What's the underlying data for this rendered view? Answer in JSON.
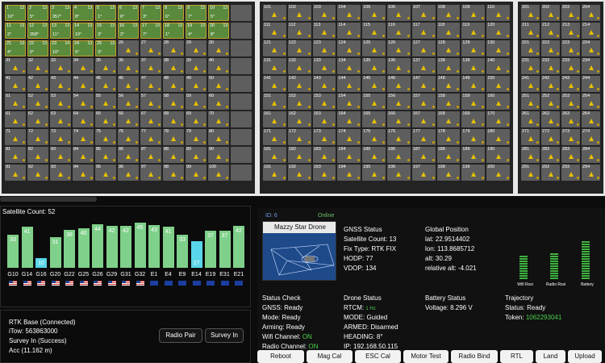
{
  "grid": {
    "panel_a": [
      {
        "n": "1",
        "s": "13",
        "h": "10°",
        "active": true
      },
      {
        "n": "2",
        "s": "13",
        "h": "5°",
        "active": true
      },
      {
        "n": "3",
        "s": "13",
        "h": "357°",
        "active": true
      },
      {
        "n": "4",
        "s": "13",
        "h": "8°",
        "active": true
      },
      {
        "n": "5",
        "s": "13",
        "h": "1°",
        "active": true
      },
      {
        "n": "6",
        "s": "13",
        "h": "6°",
        "active": true
      },
      {
        "n": "7",
        "s": "13",
        "h": "3°",
        "active": true
      },
      {
        "n": "8",
        "s": "13",
        "h": "6°",
        "active": true
      },
      {
        "n": "9",
        "s": "13",
        "h": "7°",
        "active": true
      },
      {
        "n": "10",
        "s": "13",
        "h": "5°",
        "active": true
      },
      {
        "n": "",
        "s": "",
        "h": "",
        "active": false
      },
      {
        "n": "11",
        "s": "13",
        "h": "2°",
        "active": true
      },
      {
        "n": "12",
        "s": "13",
        "h": "358°",
        "active": true
      },
      {
        "n": "13",
        "s": "13",
        "h": "11°",
        "active": true
      },
      {
        "n": "14",
        "s": "13",
        "h": "10°",
        "active": true
      },
      {
        "n": "15",
        "s": "13",
        "h": "3°",
        "active": true
      },
      {
        "n": "16",
        "s": "13",
        "h": "2°",
        "active": true
      },
      {
        "n": "17",
        "s": "13",
        "h": "7°",
        "active": true
      },
      {
        "n": "18",
        "s": "13",
        "h": "1°",
        "active": true
      },
      {
        "n": "19",
        "s": "13",
        "h": "4°",
        "active": true
      },
      {
        "n": "20",
        "s": "13",
        "h": "8°",
        "active": true
      },
      {
        "n": "",
        "s": "",
        "h": "",
        "active": false
      },
      {
        "n": "21",
        "s": "13",
        "h": "4°",
        "active": true
      },
      {
        "n": "22",
        "s": "13",
        "h": "0°",
        "active": true
      },
      {
        "n": "23",
        "s": "14",
        "h": "10°",
        "active": true
      },
      {
        "n": "24",
        "s": "13",
        "h": "5°",
        "active": true
      },
      {
        "n": "25",
        "s": "13",
        "h": "3°",
        "active": true
      },
      {
        "n": "26",
        "s": "",
        "h": "",
        "active": false
      },
      {
        "n": "27",
        "s": "",
        "h": "",
        "active": false
      },
      {
        "n": "28",
        "s": "",
        "h": "",
        "active": false
      },
      {
        "n": "29",
        "s": "",
        "h": "",
        "active": false
      },
      {
        "n": "30",
        "s": "",
        "h": "",
        "active": false
      },
      {
        "n": "",
        "s": "",
        "h": "",
        "active": false
      },
      {
        "n": "31"
      },
      {
        "n": "32"
      },
      {
        "n": "33"
      },
      {
        "n": "34"
      },
      {
        "n": "35"
      },
      {
        "n": "36"
      },
      {
        "n": "37"
      },
      {
        "n": "38"
      },
      {
        "n": "39"
      },
      {
        "n": "40"
      },
      {
        "n": ""
      },
      {
        "n": "41"
      },
      {
        "n": "42"
      },
      {
        "n": "43"
      },
      {
        "n": "44"
      },
      {
        "n": "45"
      },
      {
        "n": "46"
      },
      {
        "n": "47"
      },
      {
        "n": "48"
      },
      {
        "n": "49"
      },
      {
        "n": "50"
      },
      {
        "n": ""
      },
      {
        "n": "51"
      },
      {
        "n": "52"
      },
      {
        "n": "53"
      },
      {
        "n": "54"
      },
      {
        "n": "55"
      },
      {
        "n": "56"
      },
      {
        "n": "57"
      },
      {
        "n": "58"
      },
      {
        "n": "59"
      },
      {
        "n": "60"
      },
      {
        "n": ""
      },
      {
        "n": "61"
      },
      {
        "n": "62"
      },
      {
        "n": "63"
      },
      {
        "n": "64"
      },
      {
        "n": "65"
      },
      {
        "n": "66"
      },
      {
        "n": "67"
      },
      {
        "n": "68"
      },
      {
        "n": "69"
      },
      {
        "n": "70"
      },
      {
        "n": ""
      },
      {
        "n": "71"
      },
      {
        "n": "72"
      },
      {
        "n": "73"
      },
      {
        "n": "74"
      },
      {
        "n": "75"
      },
      {
        "n": "76"
      },
      {
        "n": "77"
      },
      {
        "n": "78"
      },
      {
        "n": "79"
      },
      {
        "n": "80"
      },
      {
        "n": ""
      },
      {
        "n": "81"
      },
      {
        "n": "82"
      },
      {
        "n": "83"
      },
      {
        "n": "84"
      },
      {
        "n": "85"
      },
      {
        "n": "86"
      },
      {
        "n": "87"
      },
      {
        "n": "88"
      },
      {
        "n": "89"
      },
      {
        "n": "90"
      },
      {
        "n": ""
      },
      {
        "n": "91"
      },
      {
        "n": "92"
      },
      {
        "n": "93"
      },
      {
        "n": "94"
      },
      {
        "n": "95"
      },
      {
        "n": "96"
      },
      {
        "n": "97"
      },
      {
        "n": "98"
      },
      {
        "n": "99"
      },
      {
        "n": "100"
      },
      {
        "n": ""
      }
    ],
    "panel_b_start": 101,
    "panel_b_count": 100,
    "panel_c": [
      "201",
      "202",
      "203",
      "204",
      "211",
      "212",
      "213",
      "214",
      "221",
      "222",
      "223",
      "224",
      "231",
      "232",
      "233",
      "234",
      "241",
      "242",
      "243",
      "244",
      "251",
      "252",
      "253",
      "254",
      "261",
      "262",
      "263",
      "264",
      "271",
      "272",
      "273",
      "274",
      "281",
      "282",
      "283",
      "284",
      "291",
      "292",
      "293",
      "294"
    ]
  },
  "satellites": {
    "title": "Satellite Count: 52",
    "items": [
      {
        "label": "G10",
        "value": "33",
        "level": 33,
        "color": "green",
        "flag": "us"
      },
      {
        "label": "G14",
        "value": "41",
        "level": 41,
        "color": "green",
        "flag": "us"
      },
      {
        "label": "G16",
        "value": "10",
        "level": 10,
        "color": "cyan",
        "flag": "us"
      },
      {
        "label": "G20",
        "value": "31",
        "level": 31,
        "color": "green",
        "flag": "us"
      },
      {
        "label": "G22",
        "value": "38",
        "level": 38,
        "color": "green",
        "flag": "us"
      },
      {
        "label": "G25",
        "value": "40",
        "level": 40,
        "color": "green",
        "flag": "us"
      },
      {
        "label": "G26",
        "value": "44",
        "level": 44,
        "color": "green",
        "flag": "us"
      },
      {
        "label": "G29",
        "value": "42",
        "level": 42,
        "color": "green",
        "flag": "us"
      },
      {
        "label": "G31",
        "value": "42",
        "level": 42,
        "color": "green",
        "flag": "us"
      },
      {
        "label": "G32",
        "value": "45",
        "level": 45,
        "color": "green",
        "flag": "us"
      },
      {
        "label": "E1",
        "value": "43",
        "level": 43,
        "color": "green",
        "flag": "eu"
      },
      {
        "label": "E4",
        "value": "41",
        "level": 41,
        "color": "green",
        "flag": "eu"
      },
      {
        "label": "E9",
        "value": "33",
        "level": 33,
        "color": "green",
        "flag": "eu"
      },
      {
        "label": "E14",
        "value": "27",
        "level": 27,
        "color": "cyan",
        "flag": "eu"
      },
      {
        "label": "E19",
        "value": "37",
        "level": 37,
        "color": "green",
        "flag": "eu"
      },
      {
        "label": "E31",
        "value": "37",
        "level": 37,
        "color": "green",
        "flag": "eu"
      },
      {
        "label": "E21",
        "value": "42",
        "level": 42,
        "color": "green",
        "flag": "eu"
      }
    ]
  },
  "rtk": {
    "base": "RTK Base (Connected)",
    "itow": "iTow: 563863000",
    "survey": "Survey In (Success)",
    "acc": "Acc (11.162 m)",
    "radio_pair": "Radio Pair",
    "survey_in": "Survey In"
  },
  "drone": {
    "id": "ID: 6",
    "online": "Online",
    "name": "Mazzy Star Drone",
    "gnss": {
      "title": "GNSS Status",
      "sat": "Satellite Count: 13",
      "fix": "Fix Type: RTK FIX",
      "hodp": "HODP: 77",
      "vdop": "VDOP: 134"
    },
    "position": {
      "title": "Global Position",
      "lat": "lat: 22.9514402",
      "lon": "lon: 113.8685712",
      "alt": "alt: 30.29",
      "rel": "relative alt: -4.021"
    },
    "signals": [
      {
        "label": "Wifi Rssi",
        "level": 0.55
      },
      {
        "label": "Radio Rssi",
        "level": 0.6
      },
      {
        "label": "Battery",
        "level": 0.9
      }
    ],
    "status_check": {
      "title": "Status Check",
      "gnss": "GNSS: Ready",
      "mode": "Mode: Ready",
      "arming": "Arming: Ready",
      "wifi_label": "Wifi Channel:",
      "wifi_value": "ON",
      "radio_label": "Radio Channel:",
      "radio_value": "ON"
    },
    "drone_status": {
      "title": "Drone Status",
      "rtcm_label": "RTCM:",
      "rtcm_value": "1 Hz",
      "mode": "MODE: Guided",
      "armed": "ARMED: Disarmed",
      "heading": "HEADING: 8°",
      "ip": "IP: 192.168.50.115"
    },
    "battery": {
      "title": "Battery Status",
      "voltage": "Voltage: 8.296 V"
    },
    "trajectory": {
      "title": "Trajectory",
      "status": "Status: Ready",
      "token_label": "Token:",
      "token_value": "1062293041"
    }
  },
  "commands": [
    "Reboot",
    "Mag Cal",
    "ESC Cal",
    "Motor Test",
    "Radio Bind",
    "RTL",
    "Land",
    "Upload"
  ]
}
